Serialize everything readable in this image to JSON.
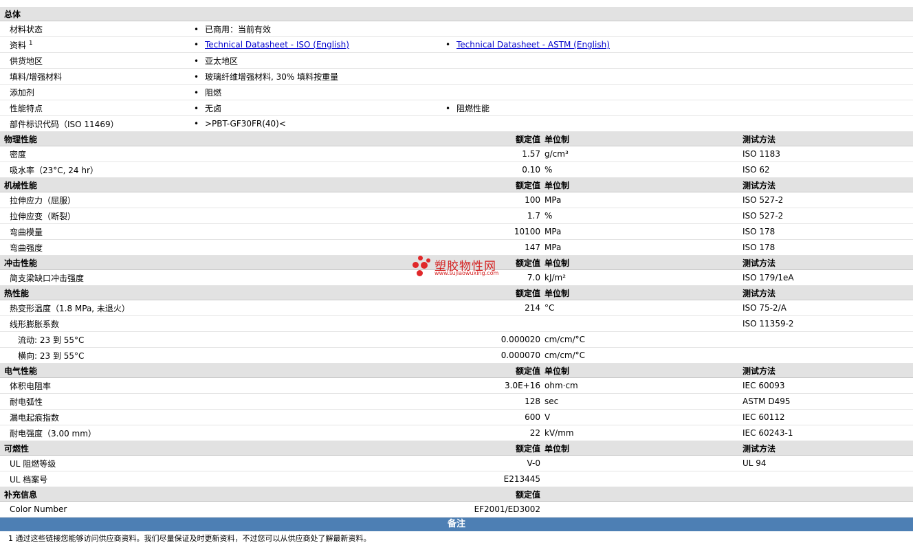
{
  "general": {
    "title": "总体",
    "rows": [
      {
        "label": "材料状态",
        "items": [
          "已商用：当前有效"
        ]
      },
      {
        "label": "资料",
        "sup": "1",
        "links": [
          "Technical Datasheet - ISO (English)",
          "Technical Datasheet - ASTM (English)"
        ]
      },
      {
        "label": "供货地区",
        "items": [
          "亚太地区"
        ]
      },
      {
        "label": "填料/增强材料",
        "items": [
          "玻璃纤维增强材料, 30% 填料按重量"
        ]
      },
      {
        "label": "添加剂",
        "items": [
          "阻燃"
        ]
      },
      {
        "label": "性能特点",
        "items": [
          "无卤",
          "阻燃性能"
        ]
      },
      {
        "label": "部件标识代码（ISO 11469）",
        "items": [
          ">PBT-GF30FR(40)<"
        ]
      }
    ]
  },
  "headers": {
    "nominal": "额定值",
    "unit": "单位制",
    "method": "测试方法"
  },
  "physical": {
    "title": "物理性能",
    "rows": [
      {
        "label": "密度",
        "value": "1.57",
        "unit": "g/cm³",
        "method": "ISO 1183"
      },
      {
        "label": "吸水率（23°C, 24 hr）",
        "value": "0.10",
        "unit": "%",
        "method": "ISO 62"
      }
    ]
  },
  "mechanical": {
    "title": "机械性能",
    "rows": [
      {
        "label": "拉伸应力（屈服）",
        "value": "100",
        "unit": "MPa",
        "method": "ISO 527-2"
      },
      {
        "label": "拉伸应变（断裂）",
        "value": "1.7",
        "unit": "%",
        "method": "ISO 527-2"
      },
      {
        "label": "弯曲模量",
        "value": "10100",
        "unit": "MPa",
        "method": "ISO 178"
      },
      {
        "label": "弯曲强度",
        "value": "147",
        "unit": "MPa",
        "method": "ISO 178"
      }
    ]
  },
  "impact": {
    "title": "冲击性能",
    "rows": [
      {
        "label": "简支梁缺口冲击强度",
        "value": "7.0",
        "unit": "kJ/m²",
        "method": "ISO 179/1eA"
      }
    ]
  },
  "thermal": {
    "title": "热性能",
    "rows": [
      {
        "label": "热变形温度（1.8 MPa, 未退火）",
        "value": "214",
        "unit": "°C",
        "method": "ISO 75-2/A"
      },
      {
        "label": "线形膨胀系数",
        "value": "",
        "unit": "",
        "method": "ISO 11359-2"
      },
      {
        "label": "流动: 23 到 55°C",
        "value": "0.000020",
        "unit": "cm/cm/°C",
        "method": ""
      },
      {
        "label": "横向: 23 到 55°C",
        "value": "0.000070",
        "unit": "cm/cm/°C",
        "method": ""
      }
    ]
  },
  "electrical": {
    "title": "电气性能",
    "rows": [
      {
        "label": "体积电阻率",
        "value": "3.0E+16",
        "unit": "ohm·cm",
        "method": "IEC 60093"
      },
      {
        "label": "耐电弧性",
        "value": "128",
        "unit": "sec",
        "method": "ASTM D495"
      },
      {
        "label": "漏电起痕指数",
        "value": "600",
        "unit": "V",
        "method": "IEC 60112"
      },
      {
        "label": "耐电强度（3.00 mm）",
        "value": "22",
        "unit": "kV/mm",
        "method": "IEC 60243-1"
      }
    ]
  },
  "flammability": {
    "title": "可燃性",
    "rows": [
      {
        "label": "UL 阻燃等级",
        "value": "V-0",
        "unit": "",
        "method": "UL 94"
      },
      {
        "label": "UL 档案号",
        "value": "E213445",
        "unit": "",
        "method": ""
      }
    ]
  },
  "supplemental": {
    "title": "补充信息",
    "rows": [
      {
        "label": "Color Number",
        "value": "EF2001/ED3002"
      }
    ]
  },
  "notes": {
    "title": "备注",
    "footnote": "1 通过这些链接您能够访问供应商资料。我们尽量保证及时更新资料，不过您可以从供应商处了解最新资料。"
  },
  "watermark": {
    "name": "塑胶物性网",
    "url": "www.sujiaowuxing.com",
    "color": "#d42222"
  }
}
